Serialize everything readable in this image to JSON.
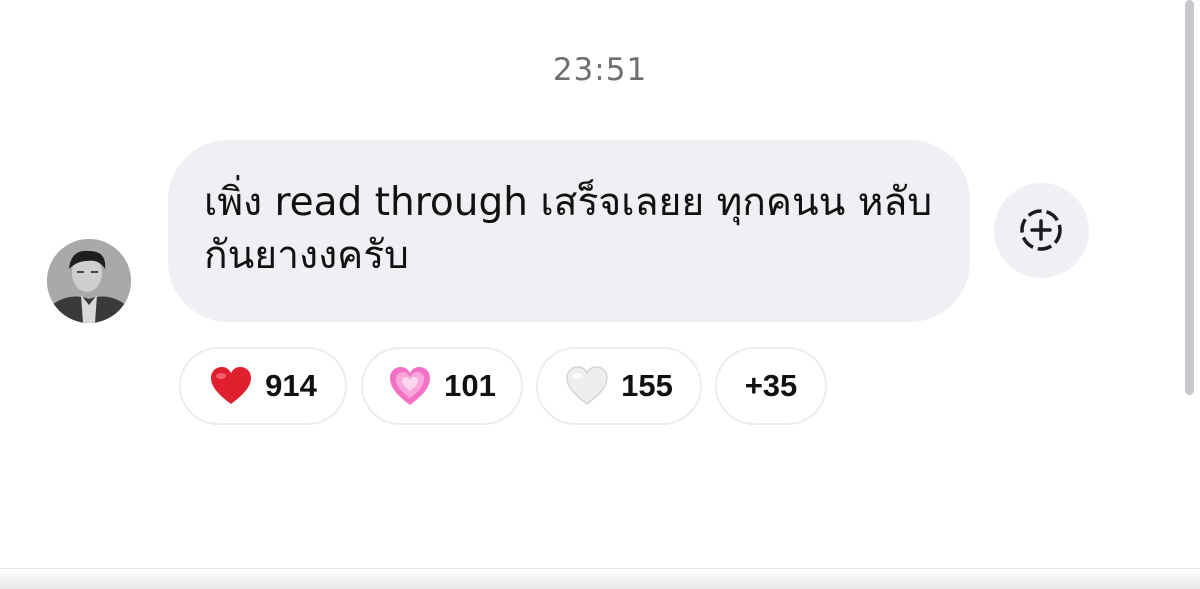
{
  "chat": {
    "timestamp": "23:51",
    "message": {
      "text": "เพิ่ง read through เสร็จเลยย ทุกคนน หลับกันยางงครับ",
      "bubble_color": "#eff0f3"
    },
    "avatar": {
      "icon": "person-photo-avatar"
    },
    "add_reaction": {
      "icon": "add-reaction-icon"
    },
    "reactions": [
      {
        "icon": "red-heart-icon",
        "color": "#e0202e",
        "count": "914"
      },
      {
        "icon": "pink-heart-icon",
        "color": "#f472c6",
        "count": "101"
      },
      {
        "icon": "white-heart-icon",
        "color": "#eeeeee",
        "count": "155"
      },
      {
        "more": "+35"
      }
    ]
  }
}
